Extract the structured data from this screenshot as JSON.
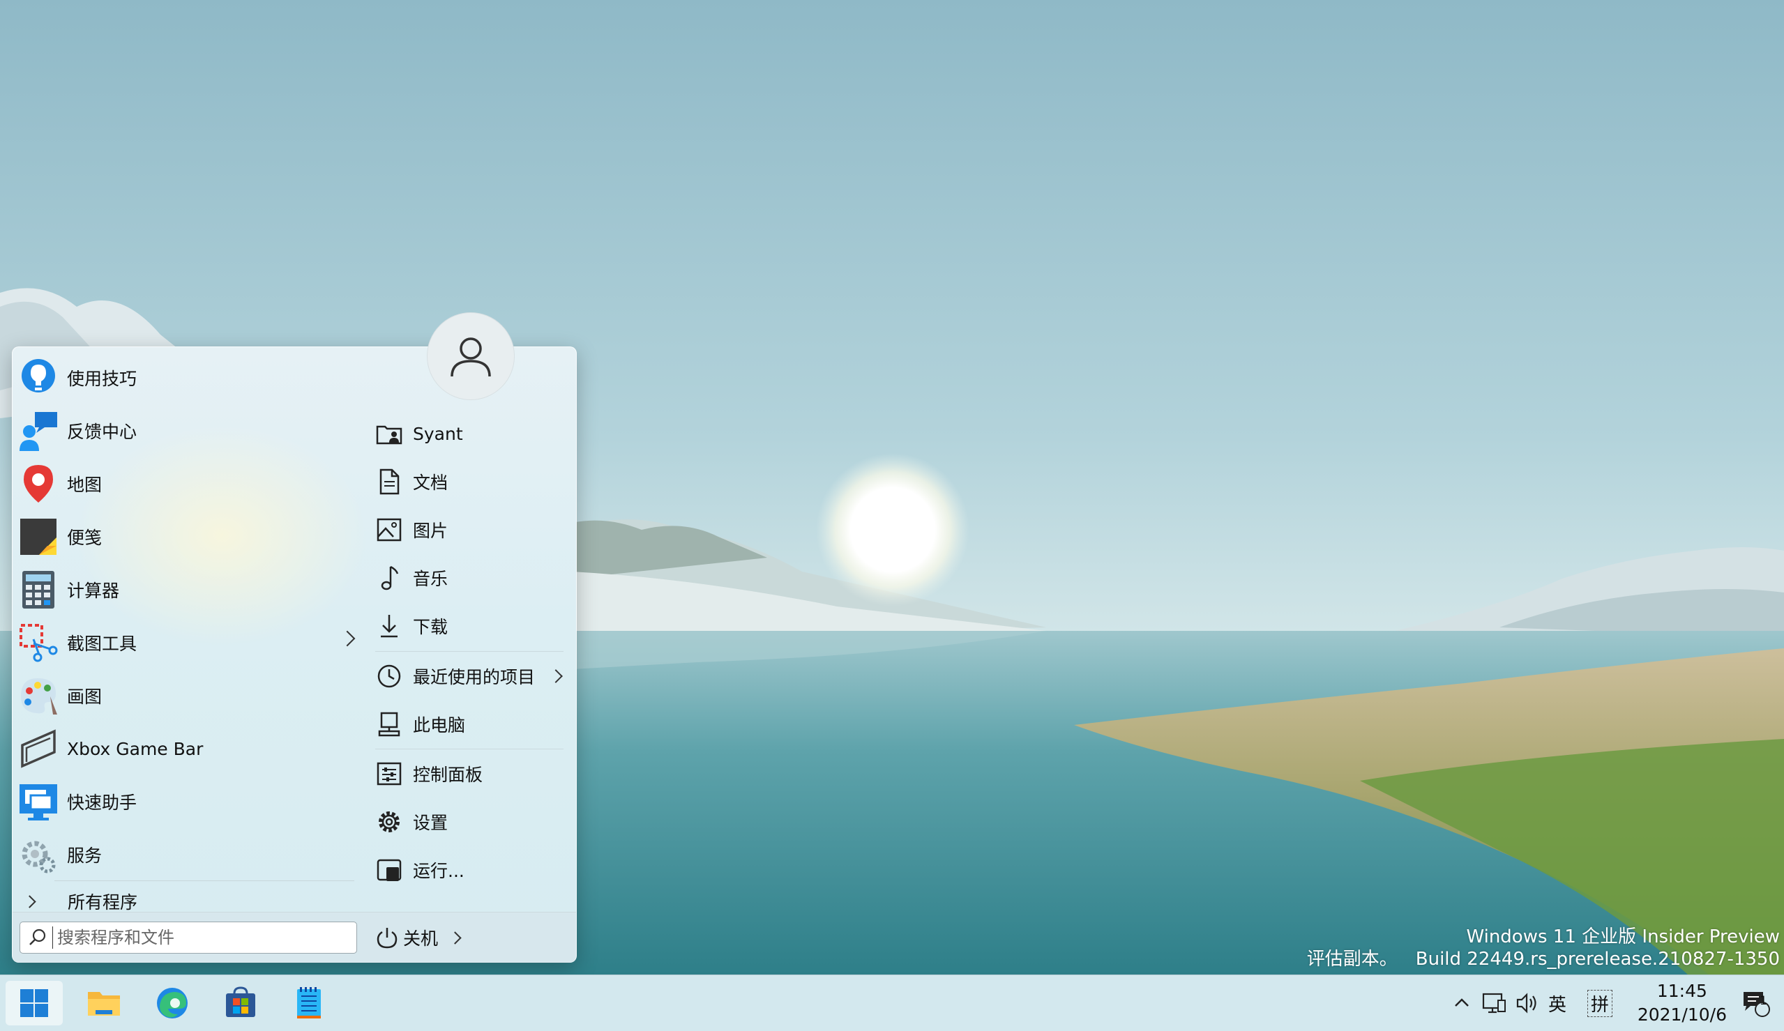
{
  "watermark": {
    "line1": "Windows 11 企业版 Insider Preview",
    "line2_left": "评估副本。",
    "line2_right": "Build 22449.rs_prerelease.210827-1350"
  },
  "start_menu": {
    "apps": [
      {
        "label": "使用技巧",
        "icon": "tips-icon"
      },
      {
        "label": "反馈中心",
        "icon": "feedback-hub-icon"
      },
      {
        "label": "地图",
        "icon": "maps-icon"
      },
      {
        "label": "便笺",
        "icon": "sticky-notes-icon"
      },
      {
        "label": "计算器",
        "icon": "calculator-icon"
      },
      {
        "label": "截图工具",
        "icon": "snipping-tool-icon"
      },
      {
        "label": "画图",
        "icon": "paint-icon"
      },
      {
        "label": "Xbox Game Bar",
        "icon": "xbox-game-bar-icon"
      },
      {
        "label": "快速助手",
        "icon": "quick-assist-icon"
      },
      {
        "label": "服务",
        "icon": "services-icon"
      }
    ],
    "all_programs": "所有程序",
    "search_placeholder": "搜索程序和文件",
    "power_label": "关机",
    "places": [
      {
        "label": "Syant",
        "icon": "user-folder-icon"
      },
      {
        "label": "文档",
        "icon": "document-icon"
      },
      {
        "label": "图片",
        "icon": "picture-icon"
      },
      {
        "label": "音乐",
        "icon": "music-icon"
      },
      {
        "label": "下载",
        "icon": "download-icon"
      },
      {
        "label": "最近使用的项目",
        "icon": "clock-icon"
      },
      {
        "label": "此电脑",
        "icon": "computer-icon"
      },
      {
        "label": "控制面板",
        "icon": "control-panel-icon"
      },
      {
        "label": "设置",
        "icon": "gear-icon"
      },
      {
        "label": "运行...",
        "icon": "run-icon"
      }
    ]
  },
  "taskbar": {
    "apps": [
      "start-icon",
      "file-explorer-icon",
      "edge-icon",
      "store-icon",
      "notepad-icon"
    ],
    "tray": {
      "lang": "英",
      "ime": "拼",
      "time": "11:45",
      "date": "2021/10/6",
      "notification_count": "1"
    }
  }
}
